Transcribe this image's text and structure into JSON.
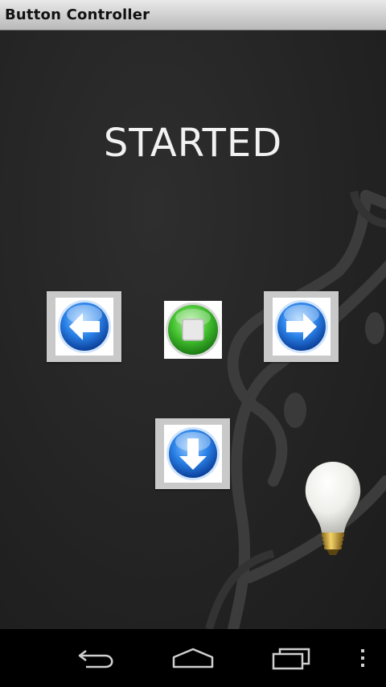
{
  "app": {
    "title": "Button Controller"
  },
  "status": {
    "text": "STARTED"
  },
  "controls": {
    "left": "left-arrow-icon",
    "stop": "stop-icon",
    "right": "right-arrow-icon",
    "down": "down-arrow-icon"
  },
  "colors": {
    "arrow_blue": "#1f74e0",
    "stop_green": "#3fbf2e",
    "background": "#242424",
    "status_text": "#f2f2f2"
  },
  "navbar": {
    "back": "back-icon",
    "home": "home-icon",
    "recents": "recent-apps-icon",
    "menu": "overflow-menu-icon"
  }
}
